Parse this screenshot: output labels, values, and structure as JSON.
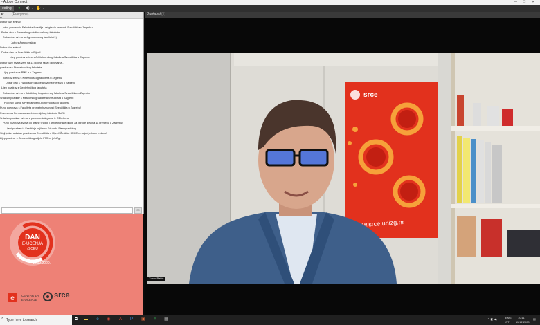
{
  "window": {
    "title": "- Adobe Connect",
    "min": "—",
    "max": "☐",
    "close": "✕"
  },
  "toolbar": {
    "meeting_label": "eeting",
    "icons": [
      "mic-icon",
      "speaker-icon",
      "hand-icon",
      "status-icon"
    ],
    "accent": "#e04a3b"
  },
  "chat": {
    "title": "at",
    "count": "(Everyone)",
    "messages": [
      "ar",
      "Dobar dan svima!",
      "jutro, pozdrav iz Fakulteta filozofije i religijskih znanosti Sveučilišta u Zagrebu",
      "Dobar dan s Rudarsko-geološko-naftnog fakulteta",
      "Dobar dan svima sa Agronomskog fakulteta! :)",
      "Jutro s Agronomskog",
      "Dobar dan svima!",
      "Dobar dan sa Sveučilišta u Rijeci!",
      "Lijep pozdrav svima s Arhitektonskog fakulteta Sveučilišta u Zagrebu",
      "Dobar dan! Hvala vam na 13 godina rada i djelovanja...",
      "pozdrav sa Stomatološkog fakulteta!",
      "Lijep pozdrav s PMF-a u Zagrebu",
      "pozdrav svima s Kineziološkog fakulteta u zagrebu",
      "Dobar dan s Fizioloških fakulteta Svi Inženjerstva u Zagrebu",
      "Lijep pozdrav s Geotehničkog fakulteta",
      "Dobar dan svima s Katoličkog bogoslovnog fakulteta Sveučilišta u Zagrebu",
      "Srdačan pozdrav s Metalurškog fakulteta Sveučilišta u Zagrebu",
      "Pozdrav svima s Prehrambeno-biotehnološkog fakulteta",
      "Puno pozdrava s Fakulteta prometnih znanosti Sveučilišta u Zagrebu!",
      "Pozdrav sa Farmaceutsko-biokemijskog fakulteta SuZG",
      "Srdačan pozdrav svima, a posebno kolegama iz CEU-bera!",
      "Puno pozdrava svima od drame tiraling i arhitektonske grupe za prirode dizajna sa primjenu u Zagrebu!",
      "Lijepi pozdrav iz Središnje knjižnice Eduardo Stenogradskog",
      "Stoji jedan srdačan pozdrav sa Sveučilišta u Rijeci! Čestitke SRCE-u na još jednom e-danu!",
      "Lijep pozdrav s Geotehničkog odjela PMF-a (UniZg)"
    ]
  },
  "promo": {
    "dan": "DAN",
    "eucenja": "E-UČENJA",
    "ceu": "@CEU",
    "date": "11.12.2020.",
    "centar_line1": "CENTAR ZA",
    "centar_line2": "E-UČENJE",
    "srce": "srce",
    "brand_bg": "#ee8176",
    "brand_red": "#e2311d"
  },
  "video": {
    "title": "Predavač",
    "count": "(1)",
    "name_tag": "Zoran Bekić",
    "banner_text": "www.srce.unizg.hr"
  },
  "taskbar": {
    "search_placeholder": "Type here to search",
    "apps": [
      "task-view",
      "explorer",
      "edge",
      "chrome",
      "acrobat",
      "photoshop",
      "word",
      "excel",
      "other"
    ],
    "lang": "ENG",
    "region": "GT",
    "time": "10:11",
    "date": "11.12.2020."
  }
}
